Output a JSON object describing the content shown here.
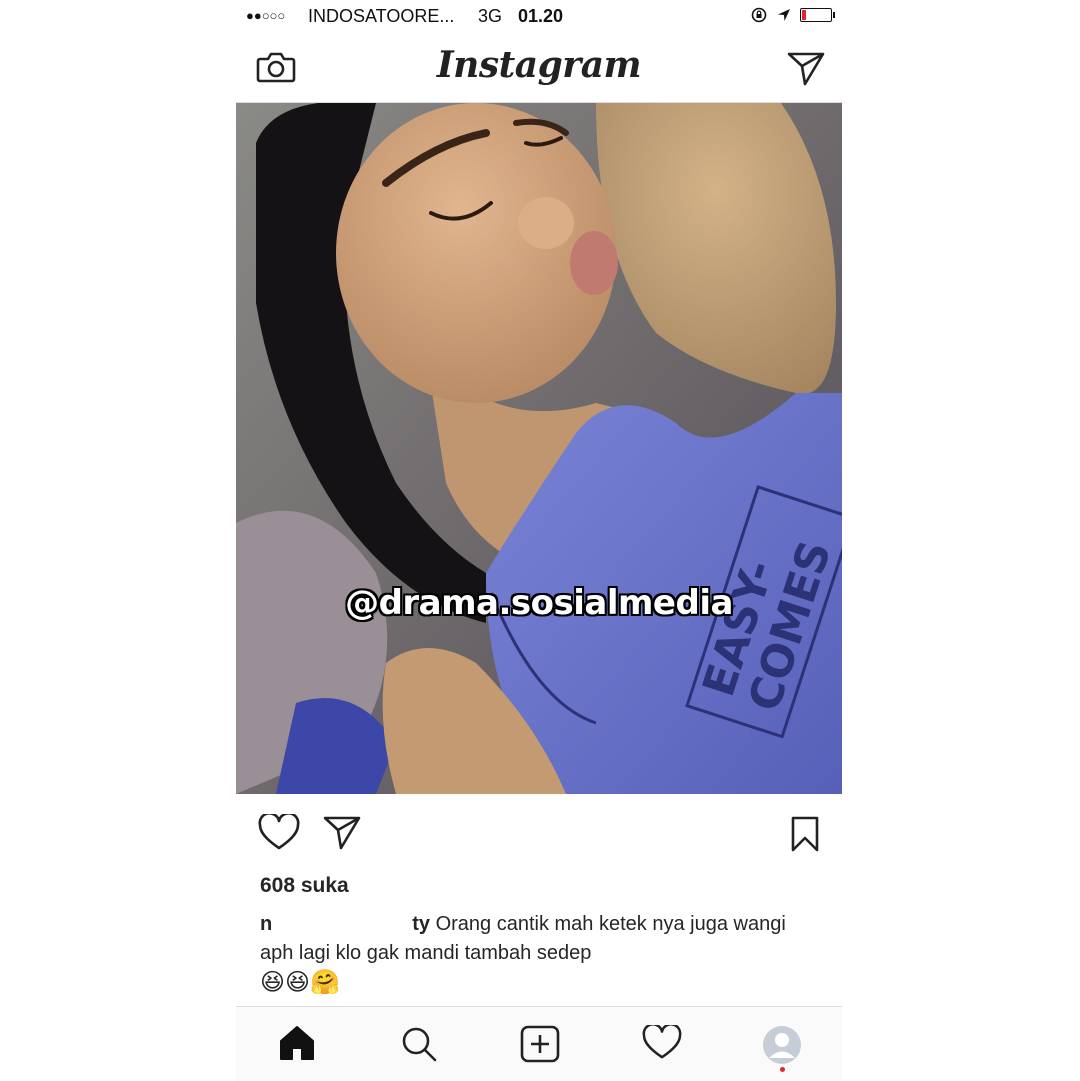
{
  "status_bar": {
    "signal": "●●○○○",
    "carrier": "INDOSATOORE...",
    "network": "3G",
    "time": "01.20"
  },
  "header": {
    "logo": "Instagram",
    "icons": [
      "camera-icon",
      "direct-message-icon"
    ]
  },
  "post": {
    "watermark": "@drama.sosialmedia",
    "shirt_text": [
      "EASY-",
      "COMES"
    ],
    "actions": [
      "heart-icon",
      "share-icon",
      "bookmark-icon"
    ],
    "likes": "608 suka",
    "caption_user_start": "n",
    "caption_user_end": "ty",
    "caption_text": "Orang cantik mah ketek nya juga wangi aph lagi klo gak mandi tambah sedep",
    "caption_emojis": "😆😆🤗"
  },
  "tab_bar": {
    "tabs": [
      "home-icon",
      "search-icon",
      "add-icon",
      "activity-icon",
      "profile-icon"
    ]
  },
  "colors": {
    "accent_red": "#e0262e",
    "border": "#dcdcdc",
    "text": "#262626"
  }
}
